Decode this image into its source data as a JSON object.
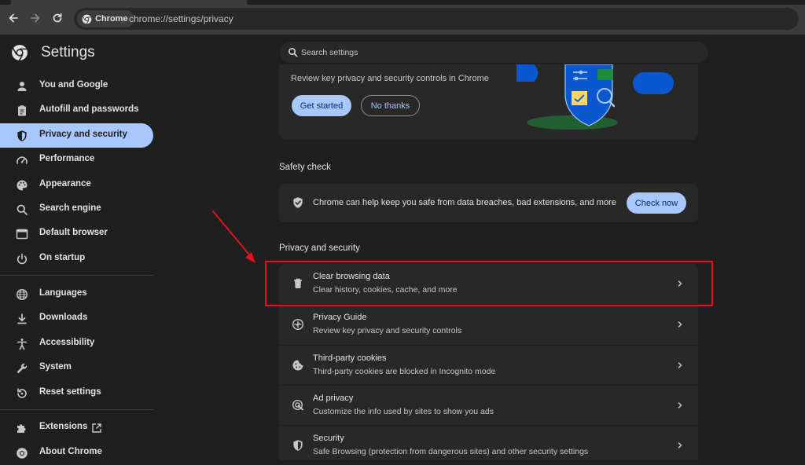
{
  "browser": {
    "chip_label": "Chrome",
    "url": "chrome://settings/privacy"
  },
  "app": {
    "title": "Settings"
  },
  "sidebar": {
    "items": [
      {
        "label": "You and Google",
        "icon": "person-icon"
      },
      {
        "label": "Autofill and passwords",
        "icon": "clipboard-icon"
      },
      {
        "label": "Privacy and security",
        "icon": "shield-icon",
        "active": true
      },
      {
        "label": "Performance",
        "icon": "speedometer-icon"
      },
      {
        "label": "Appearance",
        "icon": "palette-icon"
      },
      {
        "label": "Search engine",
        "icon": "search-icon"
      },
      {
        "label": "Default browser",
        "icon": "browser-icon"
      },
      {
        "label": "On startup",
        "icon": "power-icon"
      },
      {
        "label": "Languages",
        "icon": "globe-icon"
      },
      {
        "label": "Downloads",
        "icon": "download-icon"
      },
      {
        "label": "Accessibility",
        "icon": "accessibility-icon"
      },
      {
        "label": "System",
        "icon": "wrench-icon"
      },
      {
        "label": "Reset settings",
        "icon": "reset-icon"
      },
      {
        "label": "Extensions",
        "icon": "puzzle-icon"
      },
      {
        "label": "About Chrome",
        "icon": "chrome-icon"
      }
    ]
  },
  "search": {
    "placeholder": "Search settings"
  },
  "promo": {
    "text": "Review key privacy and security controls in Chrome",
    "primary_label": "Get started",
    "secondary_label": "No thanks"
  },
  "safety_check": {
    "title": "Safety check",
    "text": "Chrome can help keep you safe from data breaches, bad extensions, and more",
    "button_label": "Check now"
  },
  "privacy": {
    "title": "Privacy and security",
    "rows": [
      {
        "title": "Clear browsing data",
        "subtitle": "Clear history, cookies, cache, and more",
        "icon": "trash-icon"
      },
      {
        "title": "Privacy Guide",
        "subtitle": "Review key privacy and security controls",
        "icon": "compass-icon"
      },
      {
        "title": "Third-party cookies",
        "subtitle": "Third-party cookies are blocked in Incognito mode",
        "icon": "cookie-icon"
      },
      {
        "title": "Ad privacy",
        "subtitle": "Customize the info used by sites to show you ads",
        "icon": "ad-privacy-icon"
      },
      {
        "title": "Security",
        "subtitle": "Safe Browsing (protection from dangerous sites) and other security settings",
        "icon": "shield-icon"
      }
    ]
  },
  "colors": {
    "accent": "#a8c7fa",
    "annotation_red": "#e3121b",
    "background": "#1f1f1f",
    "card": "#282828"
  }
}
